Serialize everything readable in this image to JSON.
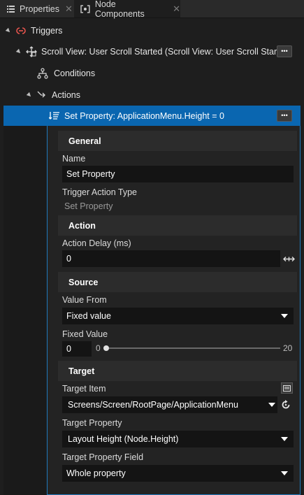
{
  "tabs": [
    {
      "label": "Properties",
      "icon": "properties-icon"
    },
    {
      "label": "Node Components",
      "icon": "node-components-icon"
    }
  ],
  "tree": {
    "triggers": "Triggers",
    "scroll_view": "Scroll View: User Scroll Started (Scroll View: User Scroll Started)",
    "conditions": "Conditions",
    "actions": "Actions",
    "selected_action": "Set Property: ApplicationMenu.Height = 0",
    "more_glyph": "•••"
  },
  "general": {
    "header": "General",
    "name_label": "Name",
    "name_value": "Set Property",
    "type_label": "Trigger Action Type",
    "type_value": "Set Property"
  },
  "action": {
    "header": "Action",
    "delay_label": "Action Delay (ms)",
    "delay_value": "0"
  },
  "source": {
    "header": "Source",
    "value_from_label": "Value From",
    "value_from_value": "Fixed value",
    "fixed_value_label": "Fixed Value",
    "fixed_value": "0",
    "slider_min": "0",
    "slider_max": "20",
    "slider_level": 0
  },
  "target": {
    "header": "Target",
    "item_label": "Target Item",
    "item_value": "Screens/Screen/RootPage/ApplicationMenu",
    "property_label": "Target Property",
    "property_value": "Layout Height (Node.Height)",
    "field_label": "Target Property Field",
    "field_value": "Whole property"
  },
  "colors": {
    "accent": "#0a66b0",
    "trigger_icon": "#e8554e",
    "background": "#1e1e1e"
  }
}
